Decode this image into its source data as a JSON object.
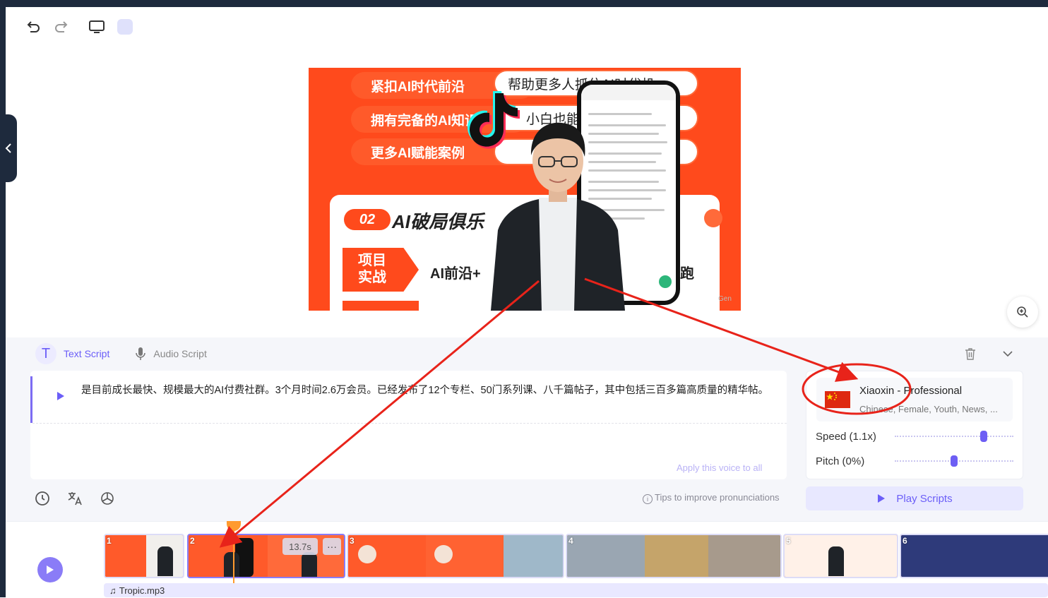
{
  "slide": {
    "row1_left": "紧扣AI时代前沿",
    "row1_right": "帮助更多人抓住AI时代机",
    "row2_left": "拥有完备的AI知识",
    "row2_right": "小白也能",
    "row3_left": "更多AI赋能案例",
    "badge_num": "02",
    "club_title": "AI破局俱乐",
    "project_label": "项目\n实战",
    "project_text": "AI前沿+",
    "project_text_right": "跑",
    "watermark": "Gen"
  },
  "script": {
    "tab_text": "Text Script",
    "tab_audio": "Audio Script",
    "text": "是目前成长最快、规模最大的AI付费社群。3个月时间2.6万会员。已经发布了12个专栏、50门系列课、八千篇帖子，其中包括三百多篇高质量的精华帖。",
    "apply_voice": "Apply this voice to all",
    "tips": "Tips to improve pronunciations"
  },
  "voice": {
    "name": "Xiaoxin - Professional",
    "desc": "Chinese, Female, Youth, News, ...",
    "speed_label": "Speed (1.1x)",
    "pitch_label": "Pitch (0%)",
    "speed_value": 1.1,
    "pitch_value": 0,
    "play_scripts": "Play Scripts"
  },
  "timeline": {
    "clips": [
      {
        "num": "1"
      },
      {
        "num": "2"
      },
      {
        "num": "3"
      },
      {
        "num": "4"
      },
      {
        "num": "5"
      },
      {
        "num": "6"
      }
    ],
    "duration": "13.7s",
    "more": "···",
    "audio": "Tropic.mp3"
  },
  "colors": {
    "accent": "#6b5ef8",
    "slide_orange": "#ff4a1c",
    "annotation_red": "#e8231a",
    "playhead": "#ff9a2e"
  }
}
